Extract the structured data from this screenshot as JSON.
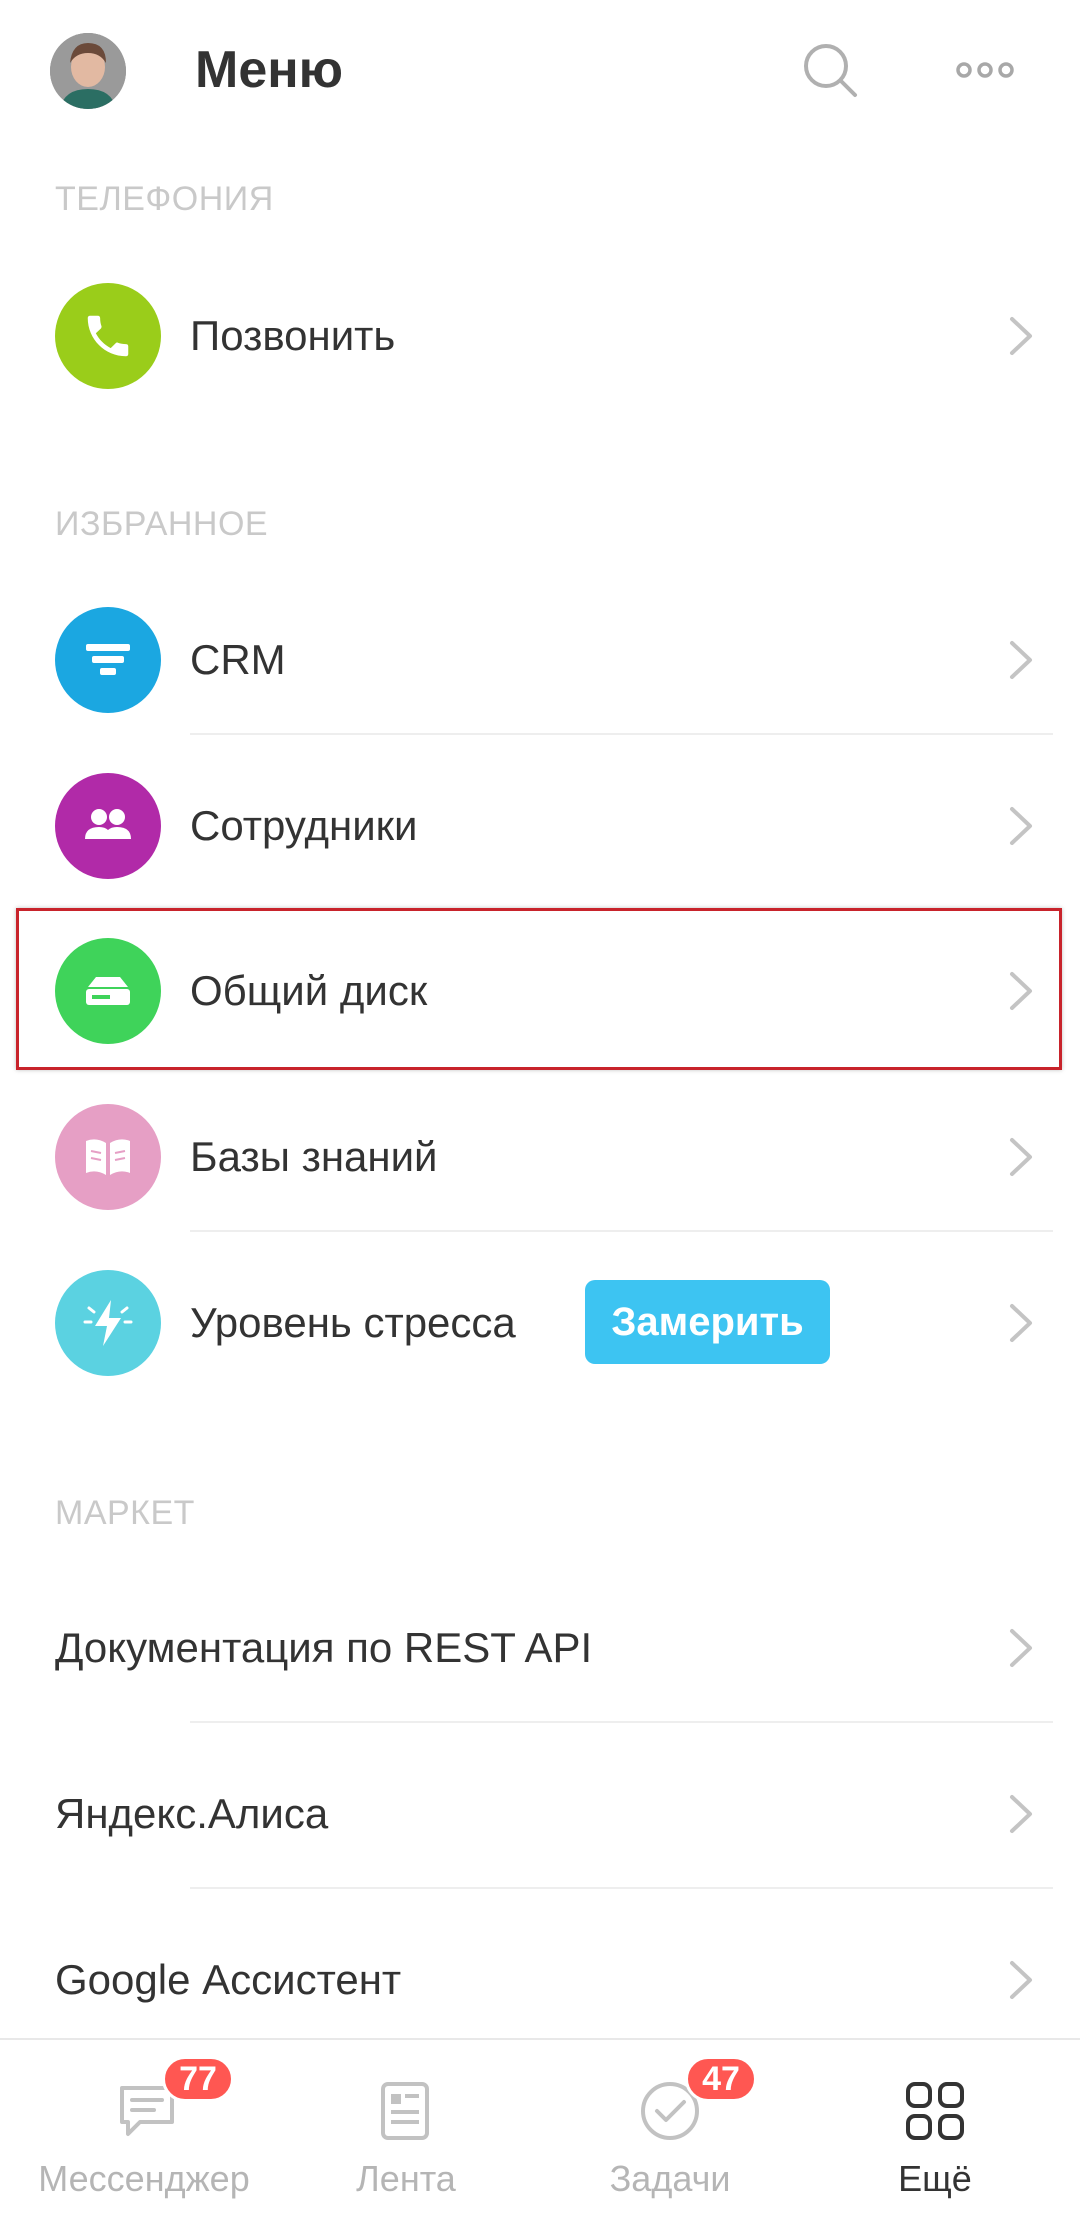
{
  "header": {
    "title": "Меню",
    "search_icon": "search-icon",
    "more_icon": "more-dots-icon"
  },
  "sections": {
    "telephony": {
      "label": "ТЕЛЕФОНИЯ",
      "items": [
        {
          "label": "Позвонить",
          "icon": "phone-icon",
          "color": "#9acd1a"
        }
      ]
    },
    "favorites": {
      "label": "ИЗБРАННОЕ",
      "items": [
        {
          "label": "CRM",
          "icon": "filter-icon",
          "color": "#1ba7e1"
        },
        {
          "label": "Сотрудники",
          "icon": "people-icon",
          "color": "#b12aa8"
        },
        {
          "label": "Общий диск",
          "icon": "drive-icon",
          "color": "#3fd35a"
        },
        {
          "label": "Базы знаний",
          "icon": "book-icon",
          "color": "#e69fc5"
        },
        {
          "label": "Уровень стресса",
          "icon": "lightning-icon",
          "color": "#5bd2e1",
          "action_label": "Замерить"
        }
      ]
    },
    "market": {
      "label": "МАРКЕТ",
      "items": [
        {
          "label": "Документация по REST API"
        },
        {
          "label": "Яндекс.Алиса"
        },
        {
          "label": "Google Ассистент"
        }
      ]
    }
  },
  "tabbar": {
    "tabs": [
      {
        "label": "Мессенджер",
        "icon": "chat-icon",
        "badge": "77"
      },
      {
        "label": "Лента",
        "icon": "feed-icon"
      },
      {
        "label": "Задачи",
        "icon": "check-circle-icon",
        "badge": "47"
      },
      {
        "label": "Ещё",
        "icon": "grid-icon",
        "active": true
      }
    ]
  }
}
